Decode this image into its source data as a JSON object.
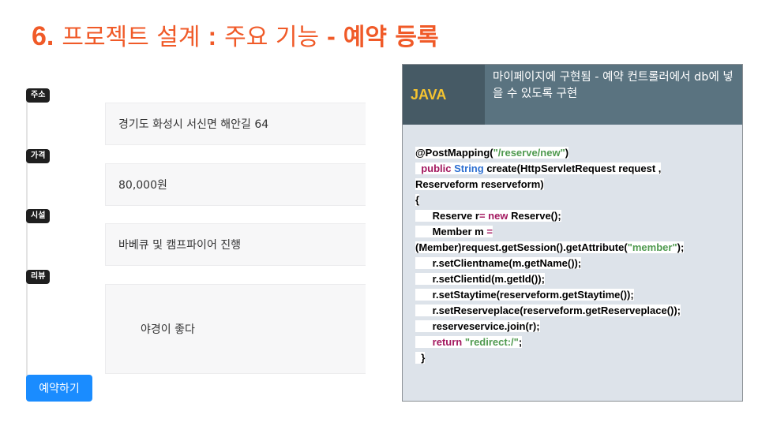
{
  "title": {
    "number": "6.",
    "part1": "프로젝트 설계",
    "colon": ":",
    "part2": "주요 기능",
    "dash": "-",
    "part3": "예약 등록"
  },
  "form": {
    "address_label": "주소",
    "address_value": "경기도 화성시 서신면 해안길 64",
    "price_label": "가격",
    "price_value": "80,000원",
    "facility_label": "시설",
    "facility_value": "바베큐 및 캠프파이어 진행",
    "review_label": "리뷰",
    "review_value": "야경이 좋다",
    "reserve_button": "예약하기"
  },
  "code": {
    "language": "JAVA",
    "description": "마이페이지에 구현됨 - 예약 컨트롤러에서 db에 넣을 수 있도록 구현",
    "lines": [
      [
        {
          "t": "@PostMapping(",
          "c": ""
        },
        {
          "t": "\"/reserve/new\"",
          "c": "st"
        },
        {
          "t": ")",
          "c": ""
        }
      ],
      [
        {
          "t": "  ",
          "c": ""
        },
        {
          "t": "public",
          "c": "kw"
        },
        {
          "t": " ",
          "c": ""
        },
        {
          "t": "String",
          "c": "ty"
        },
        {
          "t": " create(HttpServletRequest request ,",
          "c": ""
        }
      ],
      [
        {
          "t": "Reserveform reserveform)",
          "c": ""
        }
      ],
      [
        {
          "t": "{",
          "c": ""
        }
      ],
      [
        {
          "t": "      Reserve r",
          "c": ""
        },
        {
          "t": "=",
          "c": "kw"
        },
        {
          "t": " ",
          "c": ""
        },
        {
          "t": "new",
          "c": "kw"
        },
        {
          "t": " Reserve();",
          "c": ""
        }
      ],
      [
        {
          "t": "      Member m ",
          "c": ""
        },
        {
          "t": "=",
          "c": "kw"
        }
      ],
      [
        {
          "t": "(Member)request.getSession().getAttribute(",
          "c": ""
        },
        {
          "t": "\"member\"",
          "c": "st"
        },
        {
          "t": ");",
          "c": ""
        }
      ],
      [
        {
          "t": "      r.setClientname(m.getName());",
          "c": ""
        }
      ],
      [
        {
          "t": "      r.setClientid(m.getId());",
          "c": ""
        }
      ],
      [
        {
          "t": "      r.setStaytime(reserveform.getStaytime());",
          "c": ""
        }
      ],
      [
        {
          "t": "      r.setReserveplace(reserveform.getReserveplace());",
          "c": ""
        }
      ],
      [
        {
          "t": "      reserveservice.join(r);",
          "c": ""
        }
      ],
      [
        {
          "t": "      ",
          "c": ""
        },
        {
          "t": "return",
          "c": "kw"
        },
        {
          "t": " ",
          "c": ""
        },
        {
          "t": "\"redirect:/\"",
          "c": "st"
        },
        {
          "t": ";",
          "c": ""
        }
      ],
      [
        {
          "t": "  }",
          "c": ""
        }
      ]
    ]
  },
  "colors": {
    "accent": "#f05a28",
    "button": "#1a8cff",
    "code_header": "#5a7380",
    "code_lang_bg": "#465a65",
    "code_lang_text": "#f5c430",
    "keyword": "#a3185f",
    "type": "#2c6fd1",
    "string": "#4f9a4f"
  }
}
